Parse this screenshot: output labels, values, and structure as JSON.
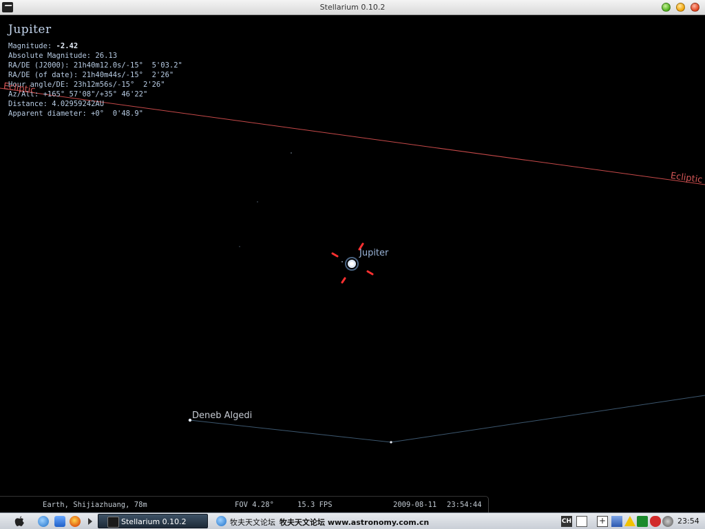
{
  "window": {
    "title": "Stellarium 0.10.2"
  },
  "object_info": {
    "name": "Jupiter",
    "magnitude_label": "Magnitude: ",
    "magnitude_value": "-2.42",
    "rows": [
      "Absolute Magnitude: 26.13",
      "RA/DE (J2000): 21h40m12.0s/-15°  5'03.2\"",
      "RA/DE (of date): 21h40m44s/-15°  2'26\"",
      "Hour angle/DE: 23h12m56s/-15°  2'26\"",
      "Az/Alt: +165° 57'08\"/+35° 46'22\"",
      "Distance: 4.02959242AU",
      "Apparent diameter: +0°  0'48.9\""
    ]
  },
  "sky": {
    "ecliptic_label": "Ecliptic",
    "selected_label": "Jupiter",
    "star_label": "Deneb Algedi",
    "colors": {
      "ecliptic": "#c84a4a",
      "constellation_line": "#3d5870",
      "selection_marker": "#ff3030",
      "planet_label": "#9ab4d8"
    }
  },
  "status_bar": {
    "location": "Earth, Shijiazhuang, 78m",
    "fov": "FOV 4.28°",
    "fps": "15.3 FPS",
    "date": "2009-08-11",
    "time": "23:54:44"
  },
  "taskbar": {
    "task_stellarium": "Stellarium 0.10.2",
    "task_browser_part1": "牧夫天文论坛",
    "task_browser_part2": "牧夫天文论坛 www.astronomy.com.cn",
    "input_method": "CH",
    "clock": "23:54",
    "icons": [
      "apple-icon",
      "ie-icon",
      "browser-icon",
      "firefox-icon",
      "keyboard-icon",
      "plus-icon",
      "network-icon",
      "warning-icon",
      "antivirus-icon",
      "shield-icon",
      "media-icon"
    ]
  }
}
